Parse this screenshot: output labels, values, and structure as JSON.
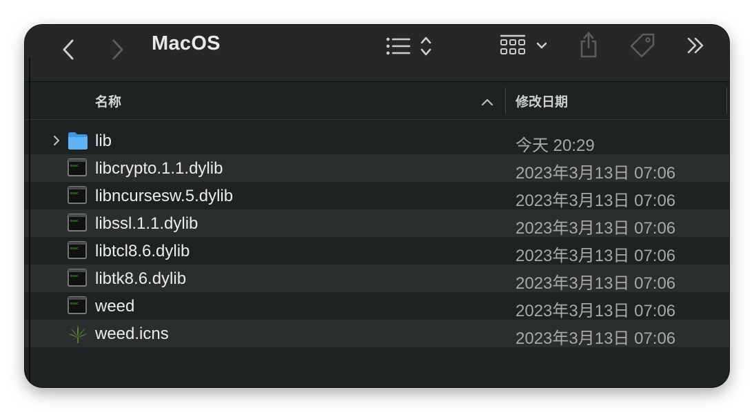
{
  "window": {
    "title": "MacOS"
  },
  "toolbar": {
    "back_icon": "chevron-left-icon",
    "forward_icon": "chevron-right-icon",
    "list_view_icon": "list-icon",
    "sort_icon": "up-down-chevron-icon",
    "grid_view_icon": "grid-icon",
    "dropdown_icon": "chevron-down-icon",
    "share_icon": "share-icon",
    "tag_icon": "tag-icon",
    "more_icon": "double-chevron-right-icon"
  },
  "columns": {
    "name": "名称",
    "date": "修改日期"
  },
  "files": [
    {
      "name": "lib",
      "date": "今天 20:29",
      "icon": "folder-icon",
      "expandable": true
    },
    {
      "name": "libcrypto.1.1.dylib",
      "date": "2023年3月13日 07:06",
      "icon": "terminal-exec-icon",
      "expandable": false
    },
    {
      "name": "libncursesw.5.dylib",
      "date": "2023年3月13日 07:06",
      "icon": "terminal-exec-icon",
      "expandable": false
    },
    {
      "name": "libssl.1.1.dylib",
      "date": "2023年3月13日 07:06",
      "icon": "terminal-exec-icon",
      "expandable": false
    },
    {
      "name": "libtcl8.6.dylib",
      "date": "2023年3月13日 07:06",
      "icon": "terminal-exec-icon",
      "expandable": false
    },
    {
      "name": "libtk8.6.dylib",
      "date": "2023年3月13日 07:06",
      "icon": "terminal-exec-icon",
      "expandable": false
    },
    {
      "name": "weed",
      "date": "2023年3月13日 07:06",
      "icon": "terminal-exec-icon",
      "expandable": false
    },
    {
      "name": "weed.icns",
      "date": "2023年3月13日 07:06",
      "icon": "leaf-icon",
      "expandable": false
    }
  ],
  "colors": {
    "folder": "#58aef2",
    "leaf": "#5e8d3a",
    "window_bg": "#1f2222",
    "row_alt": "#2b2e2e"
  }
}
